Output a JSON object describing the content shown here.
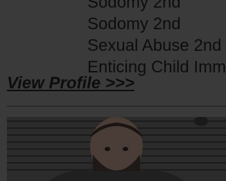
{
  "profile": {
    "charges": [
      "Sodomy 2nd",
      "Sodomy 2nd",
      "Sexual Abuse 2nd",
      "Enticing Child Imm"
    ],
    "view_profile_label": "View Profile >>>"
  },
  "mugshot": {
    "kind": "booking-photo"
  }
}
